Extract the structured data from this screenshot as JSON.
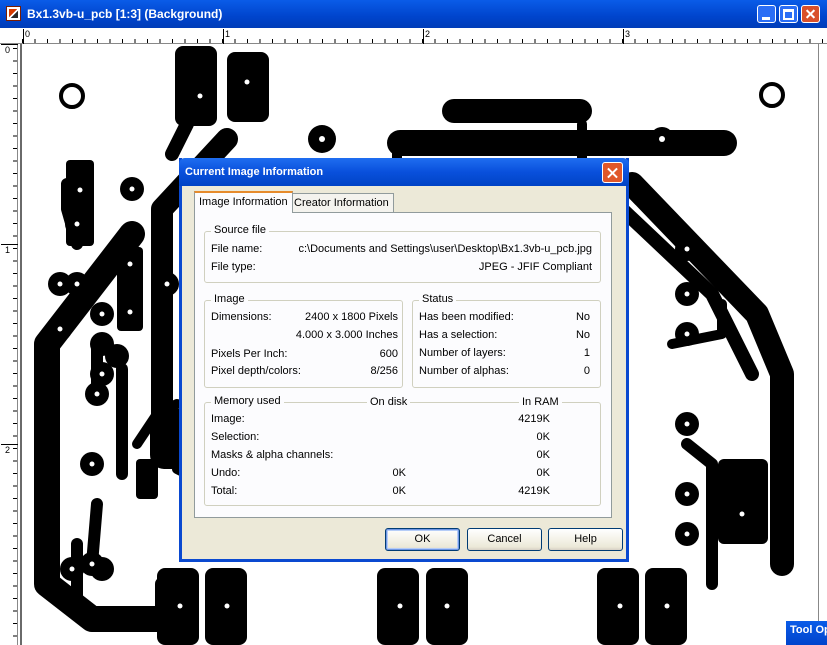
{
  "window": {
    "title": "Bx1.3vb-u_pcb [1:3] (Background)",
    "colors": {
      "titlebar": "#0054e3",
      "close": "#d9502a",
      "dialog_bg": "#ece9d8",
      "tab_accent": "#e68b2c"
    }
  },
  "ruler": {
    "top_ticks": [
      "0",
      "1",
      "2",
      "3"
    ],
    "left_ticks": [
      "0",
      "1",
      "2"
    ]
  },
  "tool_options": {
    "label": "Tool Options"
  },
  "dialog": {
    "title": "Current Image Information",
    "tabs": [
      {
        "label": "Image Information",
        "active": true
      },
      {
        "label": "Creator Information",
        "active": false
      }
    ],
    "source_file": {
      "legend": "Source file",
      "file_name_label": "File name:",
      "file_name_value": "c:\\Documents and Settings\\user\\Desktop\\Bx1.3vb-u_pcb.jpg",
      "file_type_label": "File type:",
      "file_type_value": "JPEG - JFIF Compliant"
    },
    "image": {
      "legend": "Image",
      "dimensions_label": "Dimensions:",
      "dimensions_pixels": "2400 x 1800 Pixels",
      "dimensions_inches": "4.000 x 3.000 Inches",
      "ppi_label": "Pixels Per Inch:",
      "ppi_value": "600",
      "depth_label": "Pixel depth/colors:",
      "depth_value": "8/256"
    },
    "status": {
      "legend": "Status",
      "modified_label": "Has been modified:",
      "modified_value": "No",
      "selection_label": "Has a selection:",
      "selection_value": "No",
      "layers_label": "Number of layers:",
      "layers_value": "1",
      "alphas_label": "Number of alphas:",
      "alphas_value": "0"
    },
    "memory": {
      "legend": "Memory used",
      "col_disk": "On disk",
      "col_ram": "In RAM",
      "rows": [
        {
          "label": "Image:",
          "disk": "",
          "ram": "4219K"
        },
        {
          "label": "Selection:",
          "disk": "",
          "ram": "0K"
        },
        {
          "label": "Masks & alpha channels:",
          "disk": "",
          "ram": "0K"
        },
        {
          "label": "Undo:",
          "disk": "0K",
          "ram": "0K"
        },
        {
          "label": "Total:",
          "disk": "0K",
          "ram": "4219K"
        }
      ]
    },
    "buttons": {
      "ok": "OK",
      "cancel": "Cancel",
      "help": "Help"
    }
  }
}
